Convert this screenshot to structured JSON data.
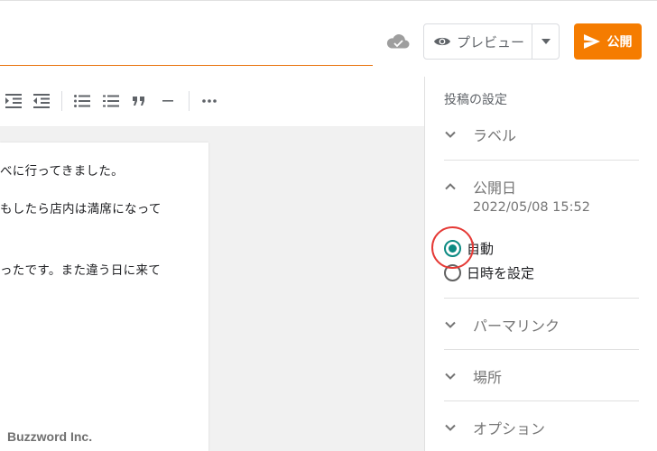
{
  "header": {
    "preview_label": "プレビュー",
    "publish_label": "公開",
    "icons": {
      "cloud": "cloud-saved-icon",
      "eye": "eye-icon",
      "dropdown": "chevron-down-icon",
      "send": "send-icon"
    },
    "accent_color": "#f57c00",
    "underline_color": "#e8710a"
  },
  "toolbar": {
    "icons": [
      "indent-icon",
      "outdent-icon",
      "bulleted-list-icon",
      "numbered-list-icon",
      "quote-icon",
      "horizontal-rule-icon",
      "more-icon"
    ]
  },
  "editor": {
    "paragraphs": [
      "べに行ってきました。",
      "もしたら店内は満席になって",
      "ったです。また違う日に来て"
    ]
  },
  "sidebar": {
    "title": "投稿の設定",
    "sections": {
      "label": "ラベル",
      "publish_date": "公開日",
      "publish_date_value": "2022/05/08 15:52",
      "permalink": "パーマリンク",
      "location": "場所",
      "options": "オプション"
    },
    "radio_options": [
      {
        "label": "自動",
        "checked": true
      },
      {
        "label": "日時を設定",
        "checked": false
      }
    ],
    "radio_color": "#0b8a82",
    "highlight_color": "#e53935"
  },
  "watermark": "Buzzword Inc."
}
